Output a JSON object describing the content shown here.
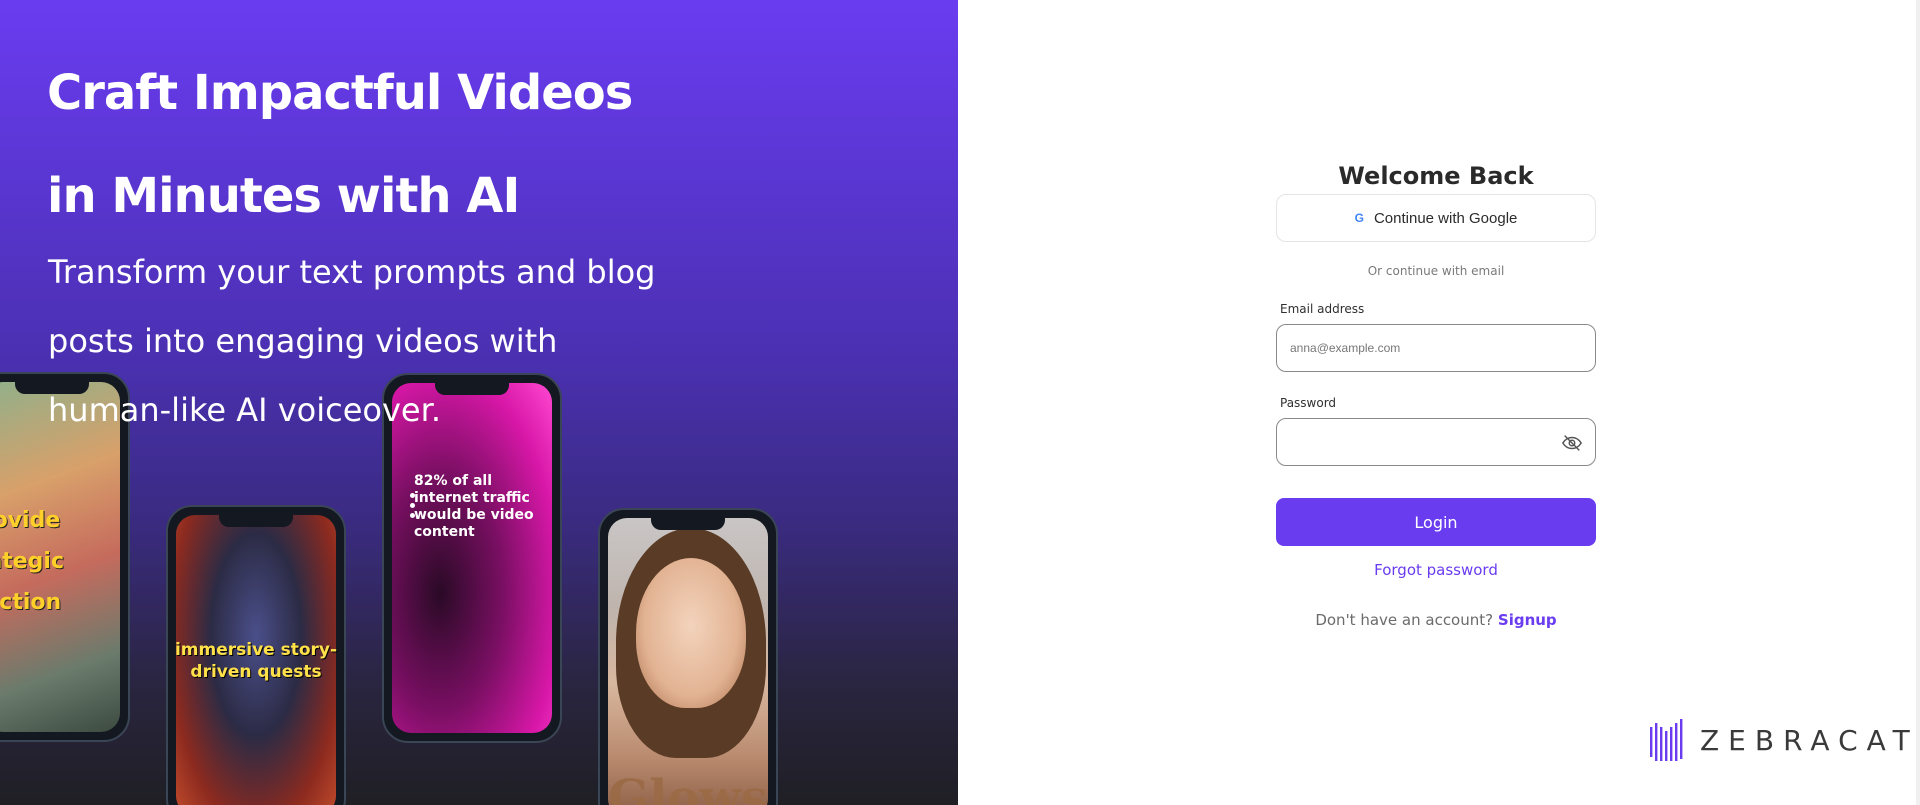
{
  "hero": {
    "title_line1": "Craft Impactful Videos",
    "title_line2": "in Minutes with AI",
    "subtitle_line1": "Transform your text prompts and blog",
    "subtitle_line2": "posts into engaging videos with",
    "subtitle_line3": "human-like AI voiceover.",
    "phones": [
      {
        "caption": "provide\ntrategic\nirection"
      },
      {
        "caption": "immersive story-driven quests"
      },
      {
        "caption": "82% of all internet traffic would be video content"
      },
      {
        "caption": "Glows"
      }
    ]
  },
  "login": {
    "title": "Welcome Back",
    "google_button": "Continue with Google",
    "google_icon": "G",
    "divider": "Or continue with email",
    "email_label": "Email address",
    "email_placeholder": "anna@example.com",
    "email_value": "",
    "password_label": "Password",
    "password_value": "",
    "password_toggle_icon": "eye-off-icon",
    "login_button": "Login",
    "forgot_password": "Forgot password",
    "no_account_text": "Don't have an account?",
    "signup_link": "Signup"
  },
  "brand": {
    "name": "ZEBRACAT",
    "accent_color": "#6a3cf0"
  }
}
